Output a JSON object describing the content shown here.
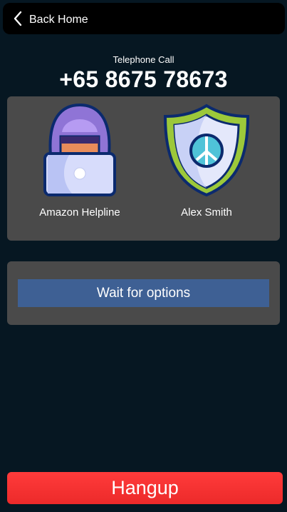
{
  "header": {
    "back_label": "Back Home",
    "back_icon": "chevron-left-icon"
  },
  "call": {
    "type_label": "Telephone Call",
    "number": "+65 8675 78673"
  },
  "participants": [
    {
      "name": "Amazon Helpline",
      "icon": "hooded-hacker-laptop-icon"
    },
    {
      "name": "Alex Smith",
      "icon": "peace-shield-icon"
    }
  ],
  "options": {
    "wait_label": "Wait for options"
  },
  "hangup": {
    "label": "Hangup"
  },
  "colors": {
    "background": "#061722",
    "panel": "#4a4a4a",
    "wait_button": "#3e6094",
    "hangup_button": "#f22f2f"
  }
}
